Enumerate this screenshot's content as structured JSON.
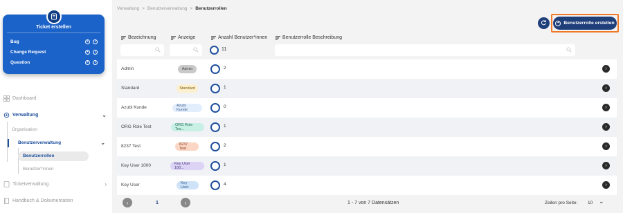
{
  "sidebar": {
    "ticket_card": {
      "title": "Ticket erstellen",
      "items": [
        {
          "label": "Bug"
        },
        {
          "label": "Change Request"
        },
        {
          "label": "Question"
        }
      ]
    },
    "nav": {
      "dashboard": "Dashboard",
      "verwaltung": "Verwaltung",
      "organisation": "Organisation",
      "benutzerverwaltung": "Benutzerverwaltung",
      "benutzerrollen": "Benutzerrollen",
      "benutzerinnen": "Benutzer*innen",
      "ticketverwaltung": "Ticketverwaltung",
      "handbuch": "Handbuch & Dokumentation"
    }
  },
  "breadcrumb": {
    "items": [
      "Verwaltung",
      ">",
      "Benutzerverwaltung",
      ">",
      "Benutzerrollen"
    ]
  },
  "toolbar": {
    "create_label": "Benutzerrolle erstellen"
  },
  "table": {
    "headers": {
      "bezeichnung": "Bezeichnung",
      "anzeige": "Anzeige",
      "anzahl": "Anzahl Benutzer*innen",
      "beschreibung": "Benutzerrolle Beschreibung"
    },
    "filter_count": "11",
    "rows": [
      {
        "name": "Admin",
        "badge": "Admin",
        "count": "2",
        "badge_bg": "#c9c9c9",
        "badge_fg": "#444444"
      },
      {
        "name": "Standard",
        "badge": "Standard",
        "count": "1",
        "badge_bg": "#fdf0cf",
        "badge_fg": "#7a5a10"
      },
      {
        "name": "Azubi Kunde",
        "badge": "Azubi Kunde",
        "count": "0",
        "badge_bg": "#e3eefc",
        "badge_fg": "#3a5d8f"
      },
      {
        "name": "ORG Role Test",
        "badge": "ORG Role Tes...",
        "count": "1",
        "badge_bg": "#c8f0e4",
        "badge_fg": "#2d6f5c"
      },
      {
        "name": "8237 Test",
        "badge": "8237 Test",
        "count": "2",
        "badge_bg": "#fbd6c4",
        "badge_fg": "#8a3f1e"
      },
      {
        "name": "Key User 1000",
        "badge": "Key User 100...",
        "count": "1",
        "badge_bg": "#dcd3f5",
        "badge_fg": "#4a3d80"
      },
      {
        "name": "Key User",
        "badge": "Key User",
        "count": "4",
        "badge_bg": "#cfe3f8",
        "badge_fg": "#2c5b8c"
      }
    ]
  },
  "pagination": {
    "current_page": "1",
    "info": "1 - 7 von 7 Datensätzen",
    "per_page_label": "Zeilen pro Seite:",
    "per_page_value": "10"
  },
  "colors": {
    "accent": "#1f3f7a",
    "ticket_card": "#1c63c9",
    "highlight": "#f07a26"
  }
}
